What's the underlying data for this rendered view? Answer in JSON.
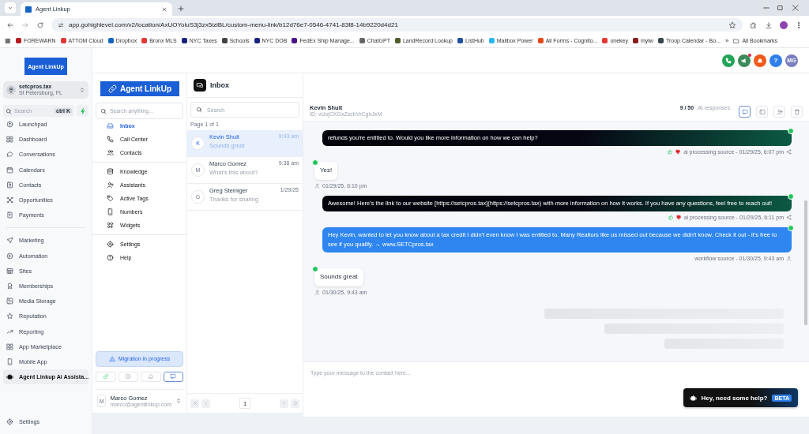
{
  "browser": {
    "tab": {
      "title": "Agent Linkup"
    },
    "url": "app.gohighlevel.com/v2/location/AxUOYoiuS3j3zx5iziBL/custom-menu-link/b12d76e7-0546-4741-83f8-14b9220d4d21",
    "bookmarks": [
      {
        "label": "FOREWARN",
        "color": "#b71c1c"
      },
      {
        "label": "ATTOM Cloud",
        "color": "#e53935"
      },
      {
        "label": "Dropbox",
        "color": "#1565c0"
      },
      {
        "label": "Bronx MLS",
        "color": "#e53935"
      },
      {
        "label": "NYC Taxes",
        "color": "#1a237e"
      },
      {
        "label": "Schools",
        "color": "#424242"
      },
      {
        "label": "NYC DOB",
        "color": "#1a237e"
      },
      {
        "label": "FedEx Ship Manage...",
        "color": "#4d148c"
      },
      {
        "label": "ChatGPT",
        "color": "#666666"
      },
      {
        "label": "LandRecord Lookup",
        "color": "#4e5d2b"
      },
      {
        "label": "ListHub",
        "color": "#1e4fa0"
      },
      {
        "label": "Mailbox Power",
        "color": "#29b6f6"
      },
      {
        "label": "All Forms - Cognito...",
        "color": "#e64a19"
      },
      {
        "label": "onekey",
        "color": "#e53935"
      },
      {
        "label": "mylw",
        "color": "#8b1a1a"
      },
      {
        "label": "Troop Calendar - Bo...",
        "color": "#37474f"
      }
    ],
    "more": "»",
    "all_bookmarks": "All Bookmarks"
  },
  "sidebar": {
    "logo": "Agent LinkUp",
    "account": {
      "name": "setcpros.tax",
      "location": "St Petersburg, FL"
    },
    "search": {
      "placeholder": "Search",
      "shortcut": "ctrl K"
    },
    "groups": [
      {
        "items": [
          {
            "label": "Launchpad",
            "selected": false
          },
          {
            "label": "Dashboard",
            "selected": false
          },
          {
            "label": "Conversations",
            "selected": false
          },
          {
            "label": "Calendars",
            "selected": false
          },
          {
            "label": "Contacts",
            "selected": false
          },
          {
            "label": "Opportunities",
            "selected": false
          },
          {
            "label": "Payments",
            "selected": false
          }
        ]
      },
      {
        "items": [
          {
            "label": "Marketing",
            "selected": false
          },
          {
            "label": "Automation",
            "selected": false
          },
          {
            "label": "Sites",
            "selected": false
          },
          {
            "label": "Memberships",
            "selected": false
          },
          {
            "label": "Media Storage",
            "selected": false
          },
          {
            "label": "Reputation",
            "selected": false
          },
          {
            "label": "Reporting",
            "selected": false
          },
          {
            "label": "App Marketplace",
            "selected": false
          },
          {
            "label": "Mobile App",
            "selected": false
          },
          {
            "label": "Agent Linkup Ai Assista...",
            "selected": true
          }
        ]
      }
    ],
    "settings": "Settings"
  },
  "header": {
    "actions": [
      {
        "kind": "phone",
        "alert": false
      },
      {
        "kind": "megaphone",
        "alert": true
      },
      {
        "kind": "bell",
        "alert": false
      }
    ],
    "help": "?",
    "avatar": "MG"
  },
  "nav_panel": {
    "logo": "Agent LinkUp",
    "search": {
      "placeholder": "Search anything..."
    },
    "groups": [
      {
        "items": [
          {
            "label": "Inbox",
            "selected": true
          },
          {
            "label": "Call Center",
            "selected": false
          },
          {
            "label": "Contacts",
            "selected": false
          }
        ]
      },
      {
        "items": [
          {
            "label": "Knowledge",
            "selected": false
          },
          {
            "label": "Assistants",
            "selected": false
          },
          {
            "label": "Active Tags",
            "selected": false
          },
          {
            "label": "Numbers",
            "selected": false
          },
          {
            "label": "Widgets",
            "selected": false
          }
        ]
      },
      {
        "items": [
          {
            "label": "Settings",
            "selected": false
          },
          {
            "label": "Help",
            "selected": false
          }
        ]
      }
    ],
    "migration": "Migration in progress",
    "tools": [
      {
        "selected": false
      },
      {
        "selected": false
      },
      {
        "selected": false
      },
      {
        "selected": true
      }
    ],
    "user": {
      "initial": "M",
      "name": "Marco Gomez",
      "email": "marco@agentlinkup.com"
    }
  },
  "inbox": {
    "title": "Inbox",
    "search": {
      "placeholder": "Search"
    },
    "page_info": "Page 1 of 1",
    "conversations": [
      {
        "initial": "K",
        "name": "Kevin Shult",
        "preview": "Sounds great",
        "time": "9:43 am",
        "selected": true
      },
      {
        "initial": "M",
        "name": "Marco Gomez",
        "preview": "What's this about?",
        "time": "9:38 am",
        "selected": false
      },
      {
        "initial": "G",
        "name": "Greg Steiniger",
        "preview": "Thanks for sharing",
        "time": "1/29/25",
        "selected": false
      }
    ],
    "pagination": {
      "page": "1"
    }
  },
  "chat": {
    "contact": {
      "name": "Kevin Shult",
      "id": "ID: vUojCKGxZscbVrCghJeM"
    },
    "ai_count": "9 / 50",
    "ai_label": "AI responses",
    "tools": [
      {
        "selected": true
      },
      {
        "selected": false
      },
      {
        "selected": false
      },
      {
        "selected": false
      }
    ],
    "messages": [
      {
        "kind": "ai",
        "text": "refunds you're entitled to. Would you like more information on how we can help?",
        "meta": "ai processing source - 01/29/25, 6:07 pm"
      },
      {
        "kind": "incoming",
        "text": "Yes!",
        "meta": "01/29/25, 6:10 pm"
      },
      {
        "kind": "ai",
        "text": "Awesome! Here's the link to our website [https://setcpros.tax](https://setcpros.tax) with more information on how it works. If you have any questions, feel free to reach out!",
        "meta": "ai processing source - 01/29/25, 6:11 pm"
      },
      {
        "kind": "workflow",
        "text": "Hey Kevin, wanted to let you know about a tax credit I didn't even know I was entitled to. Many Realtors like us missed out because we didn't know. Check it out - it's free to see if you qualify. → www.SETCpros.tax",
        "meta": "workflow source - 01/30/25, 9:43 am"
      },
      {
        "kind": "incoming",
        "text": "Sounds great",
        "meta": "01/30/25, 9:43 am"
      }
    ],
    "loading": true,
    "composer": {
      "placeholder": "Type your message to the contact here..."
    },
    "help_button": {
      "label": "Hey, need some help?",
      "badge": "BETA"
    }
  }
}
